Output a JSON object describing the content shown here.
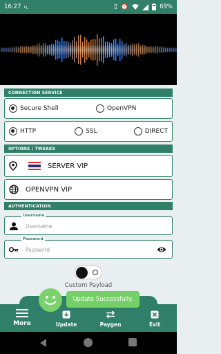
{
  "status_bar": {
    "time": "16:27",
    "carrier_glyph": "ч.",
    "battery": "69%",
    "icons": [
      "vibrate-icon",
      "alarm-icon",
      "wifi-icon",
      "signal-icon",
      "battery-icon"
    ]
  },
  "connection": {
    "section_title": "CONNECTION SERVICE",
    "service_options": [
      {
        "label": "Secure Shell",
        "selected": true
      },
      {
        "label": "OpenVPN",
        "selected": false
      }
    ],
    "protocol_options": [
      {
        "label": "HTTP",
        "selected": true
      },
      {
        "label": "SSL",
        "selected": false
      },
      {
        "label": "DIRECT",
        "selected": false
      }
    ]
  },
  "options": {
    "section_title": "OPTIONS / TWEAKS",
    "server_label": "SERVER VIP",
    "server_flag": "thailand-flag-icon",
    "vpn_label": "OPENVPN VIP"
  },
  "auth": {
    "section_title": "AUTHENTICATION",
    "username_label": "Username",
    "username_placeholder": "Username",
    "password_label": "Password",
    "password_placeholder": "Password"
  },
  "custom_payload": {
    "label": "Custom Payload",
    "enabled": false
  },
  "toast": {
    "message": "Update Successfully."
  },
  "bottom_nav": {
    "more": "More",
    "update": "Update",
    "paygen": "Paygen",
    "exit": "Exit"
  },
  "colors": {
    "primary": "#2f7f69",
    "toast": "#74cf66"
  }
}
